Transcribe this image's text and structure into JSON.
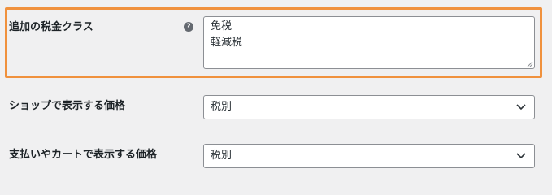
{
  "settings": {
    "additional_tax_classes": {
      "label": "追加の税金クラス",
      "help_icon": "question-circle-icon",
      "value": "免税\n軽減税"
    },
    "shop_display_price": {
      "label": "ショップで表示する価格",
      "selected": "税別"
    },
    "cart_display_price": {
      "label": "支払いやカートで表示する価格",
      "selected": "税別"
    }
  },
  "colors": {
    "highlight": "#f0913d",
    "background": "#f0f0f1",
    "field_border": "#8c8f94"
  }
}
